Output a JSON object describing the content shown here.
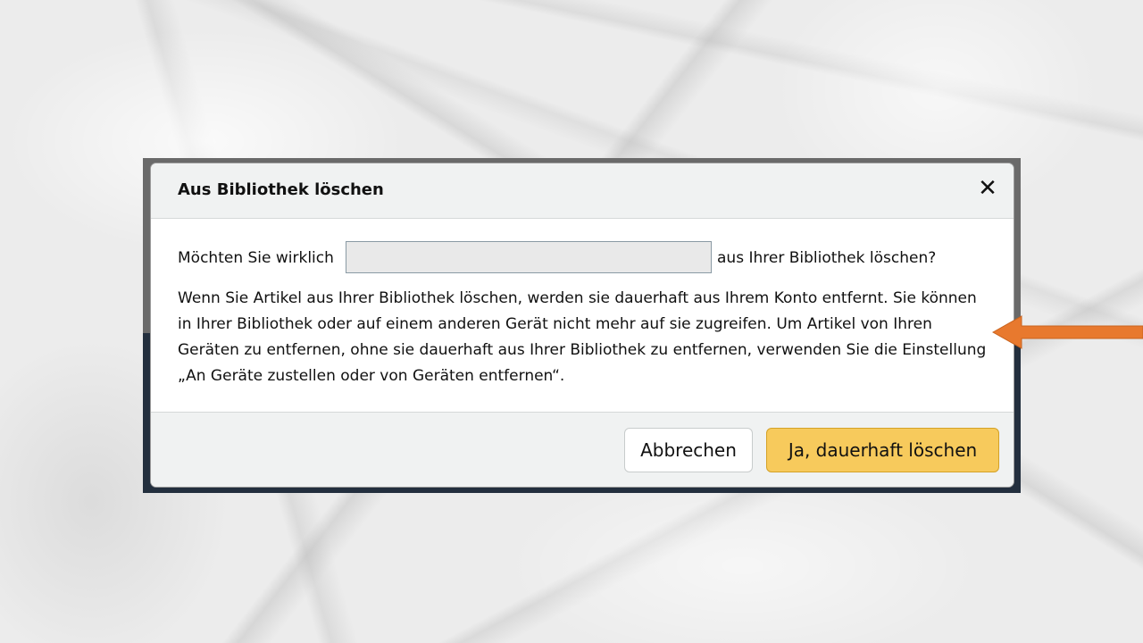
{
  "dialog": {
    "title": "Aus Bibliothek löschen",
    "close_symbol": "✕",
    "question_prefix": "Möchten Sie wirklich",
    "question_suffix": "aus Ihrer Bibliothek löschen?",
    "body": "Wenn Sie Artikel aus Ihrer Bibliothek löschen, werden sie dauerhaft aus Ihrem Konto entfernt. Sie können in Ihrer Bibliothek oder auf einem anderen Gerät nicht mehr auf sie zugreifen. Um Artikel von Ihren Geräten zu entfernen, ohne sie dauerhaft aus Ihrer Bibliothek zu entfernen, verwenden Sie die Einstellung „An Geräte zustellen oder von Geräten entfernen“.",
    "cancel_label": "Abbrechen",
    "confirm_label": "Ja, dauerhaft löschen"
  },
  "colors": {
    "confirm_button": "#f7ca5c",
    "annotation_arrow": "#e8792e",
    "header_background": "#f0f2f2"
  },
  "icons": {
    "close": "close-icon",
    "annotation": "arrow-left-icon"
  }
}
